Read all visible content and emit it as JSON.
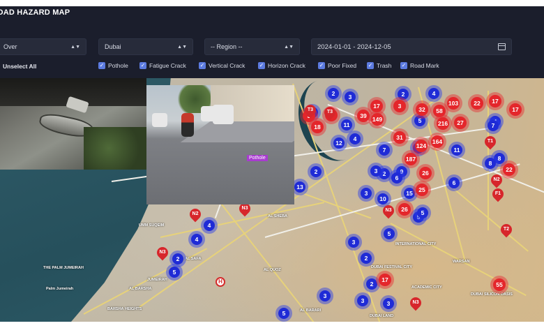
{
  "header": {
    "title": "OAD HAZARD MAP"
  },
  "filters": {
    "mode": "Over",
    "city": "Dubai",
    "region": "-- Region --",
    "date_range": "2024-01-01 - 2024-12-05",
    "unselect_all": "Unselect All",
    "hazards": [
      {
        "label": "Pothole",
        "checked": true
      },
      {
        "label": "Fatigue Crack",
        "checked": true
      },
      {
        "label": "Vertical Crack",
        "checked": true
      },
      {
        "label": "Horizon Crack",
        "checked": true
      },
      {
        "label": "Poor Fixed",
        "checked": true
      },
      {
        "label": "Trash",
        "checked": true
      },
      {
        "label": "Road Mark",
        "checked": true
      }
    ]
  },
  "inset": {
    "detection_label": "Pothole"
  },
  "map": {
    "colors": {
      "cluster_blue": "#1f2bd6",
      "cluster_red": "#e4262b"
    },
    "clusters_blue": [
      "2",
      "3",
      "2",
      "4",
      "11",
      "4",
      "5",
      "3",
      "4",
      "7",
      "2",
      "5",
      "12",
      "2",
      "3",
      "9",
      "7",
      "11",
      "8",
      "3",
      "10",
      "15",
      "6",
      "3",
      "8",
      "5",
      "6",
      "4",
      "5",
      "4",
      "2",
      "5",
      "3",
      "3",
      "5",
      "2",
      "3",
      "2",
      "6",
      "13"
    ],
    "clusters_red": [
      "17",
      "17",
      "3",
      "3",
      "39",
      "149",
      "32",
      "58",
      "103",
      "22",
      "17",
      "17",
      "18",
      "31",
      "216",
      "27",
      "124",
      "164",
      "187",
      "26",
      "22",
      "25",
      "26",
      "17",
      "55"
    ],
    "pins": [
      "T3",
      "T3",
      "N2",
      "N3",
      "N3",
      "T1",
      "N2",
      "F1",
      "N3",
      "T2",
      "N3"
    ],
    "districts": [
      "THE PALM JUMEIRAH",
      "Palm Jumeirah",
      "UMM SUQEIM",
      "AL SAFA",
      "JUMEIRAH",
      "AL BARSHA",
      "BARSHA HEIGHTS",
      "AL QUOZ",
      "AL SHEBA",
      "DUBAI FESTIVAL CITY",
      "INTERNATIONAL CITY",
      "ACADEMIC CITY",
      "WARSAN",
      "DUBAI SILICON OASIS",
      "AL BARARI",
      "DUBAI LAND"
    ]
  }
}
